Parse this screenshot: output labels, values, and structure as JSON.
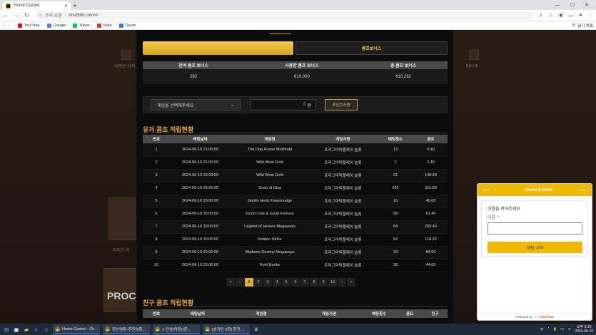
{
  "browser": {
    "tab_title": "Home Casino",
    "new_tab": "+",
    "security_warning": "주의 요함",
    "url": "hm3590.com/#/",
    "bookmarks": [
      "YouTube",
      "Google",
      "Naver",
      "Nate",
      "Daum"
    ],
    "bookmarks_right": "읽기 목록"
  },
  "background": {
    "left_label": "라이브 카지",
    "right_label": "미니게",
    "left_label2": "라이브 카",
    "left_big": "PROC"
  },
  "modal": {
    "tab_active": "",
    "tab_other": "콤프보너스",
    "summary": {
      "headers": [
        "잔여 콤프 보너스",
        "사용한 콤프 보너스",
        "총 콤프 보너스"
      ],
      "values": [
        "282",
        "610,000",
        "610,282"
      ]
    },
    "control": {
      "select_label": "게임을 선택해주세요",
      "amount": "0",
      "amount_unit": "원",
      "use_button": "포인트사용"
    },
    "user_section_title": "유저 콤프 적립현황",
    "comp_headers": [
      "번호",
      "배팅날짜",
      "게임명",
      "게임사명",
      "배팅횟수",
      "콤프"
    ],
    "comp_rows": [
      [
        "1",
        "2024-06-10 21:00:00",
        "The Dog House Multihold",
        "프라그마틱플레이 슬롯",
        "13",
        "0.40"
      ],
      [
        "2",
        "2024-06-10 21:00:00",
        "Wild West Gold",
        "프라그마틱플레이 슬롯",
        "2",
        "2.40"
      ],
      [
        "3",
        "2024-06-10 20:00:00",
        "Wild West Gold",
        "프라그마틱플레이 슬롯",
        "61",
        "148.80"
      ],
      [
        "4",
        "2024-06-10 20:00:00",
        "Gods of Giza",
        "프라그마틱플레이 슬롯",
        "240",
        "310.80"
      ],
      [
        "5",
        "2024-06-10 20:00:00",
        "Goblin Heist Powernudge",
        "프라그마틱플레이 슬롯",
        "16",
        "40.00"
      ],
      [
        "6",
        "2024-06-10 20:00:00",
        "Good Luck & Good Fortune",
        "프라그마틱플레이 슬롯",
        "89",
        "61.40"
      ],
      [
        "7",
        "2024-06-10 20:00:00",
        "Legend of Heroes Megaways",
        "프라그마틱플레이 슬롯",
        "84",
        "200.40"
      ],
      [
        "8",
        "2024-06-10 20:00:00",
        "Robber Strike",
        "프라그마틱플레이 슬롯",
        "54",
        "118.20"
      ],
      [
        "9",
        "2024-06-10 20:00:00",
        "Madame Destiny Megaways",
        "프라그마틱플레이 슬롯",
        "34",
        "84.00"
      ],
      [
        "10",
        "2024-06-10 20:00:00",
        "Reel Banks",
        "프라그마틱플레이 슬롯",
        "28",
        "44.00"
      ]
    ],
    "pager": [
      "«",
      "‹",
      "1",
      "2",
      "3",
      "4",
      "5",
      "6",
      "7",
      "8",
      "9",
      "10",
      "›",
      "»"
    ],
    "pager_current": "1",
    "friend_section_title": "친구 콤프 적립현황",
    "friend_headers": [
      "번호",
      "배팅날짜",
      "게임명",
      "게임사명",
      "배팅횟수",
      "콤프",
      "친구"
    ]
  },
  "chat": {
    "title": "Home Casino",
    "prompt": "이름을 적어주세요",
    "name_label": "이름:",
    "required": "*",
    "start_button": "채팅 시작",
    "powered_by": "Powered by",
    "brand": "LiveChat"
  },
  "taskbar": {
    "apps": [
      "Home Casino - Ch...",
      "최신영화-추천영화...",
      "> 안성(막장)(흔...",
      "[송가인 3회] 혼전 ..."
    ],
    "time": "오후 9:10",
    "date": "2024-06-10"
  }
}
